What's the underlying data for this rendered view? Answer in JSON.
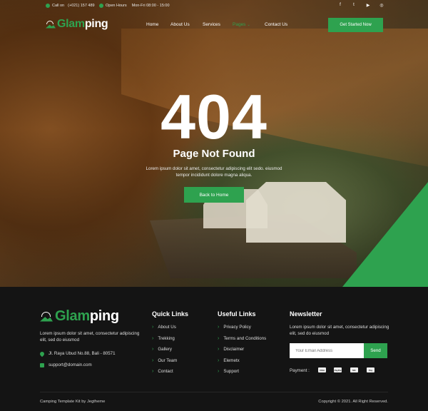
{
  "colors": {
    "accent": "#2ea24f",
    "footer_bg": "#141414"
  },
  "topbar": {
    "call_label": "Call on",
    "phone": "(+021) 157 489",
    "hours_label": "Open Hours",
    "hours": "Mon-Fri 08:00 - 15:00",
    "social": [
      {
        "icon": "facebook-icon",
        "glyph": "f"
      },
      {
        "icon": "twitter-icon",
        "glyph": "t"
      },
      {
        "icon": "youtube-icon",
        "glyph": "▶"
      },
      {
        "icon": "instagram-icon",
        "glyph": "◎"
      }
    ]
  },
  "header": {
    "logo_green": "Glam",
    "logo_white": "ping",
    "nav": [
      "Home",
      "About Us",
      "Services",
      "Pages",
      "Contact Us"
    ],
    "active_nav": "Pages",
    "cta": "Get Started Now"
  },
  "hero": {
    "code": "404",
    "title": "Page Not Found",
    "text": "Lorem ipsum dolor sit amet, consectetur adipiscing elit sedo. eiusmod tempor incididunt dolore magna aliqua.",
    "button": "Back to Home"
  },
  "footer": {
    "logo_green": "Glam",
    "logo_white": "ping",
    "description": "Lorem ipsum dolor sit amet, consectetur adipiscing elit, sed do eiusmod",
    "address": "Jl. Raya Ubud No.88, Bali - 80571",
    "email": "support@domain.com",
    "quick_links": {
      "title": "Quick Links",
      "items": [
        "About Us",
        "Trekking",
        "Gallery",
        "Our Team",
        "Contact"
      ]
    },
    "useful_links": {
      "title": "Useful Links",
      "items": [
        "Privacy Policy",
        "Terms and Conditions",
        "Disclaimer",
        "Elemetx",
        "Support"
      ]
    },
    "newsletter": {
      "title": "Newsletter",
      "text": "Lorem ipsum dolor sit amet, consectetur adipiscing elit, sed do eiusmod",
      "placeholder": "Your Email Address",
      "button": "Send",
      "payment_label": "Payment :",
      "payment_methods": [
        "VISA",
        "PayPal",
        "MC",
        "Pay"
      ]
    },
    "bottom_left": "Camping Template Kit by Jegtheme",
    "bottom_right": "Copyright © 2021. All Right Reserved."
  }
}
